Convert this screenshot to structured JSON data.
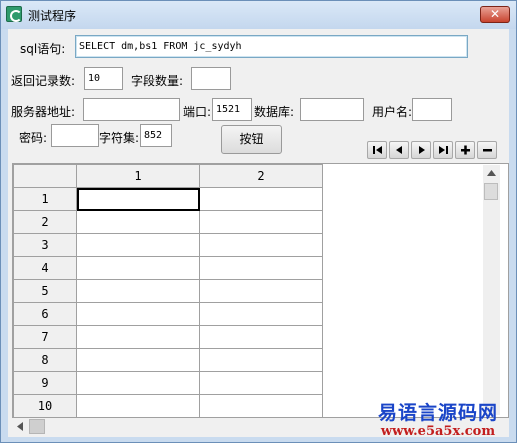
{
  "window": {
    "title": "测试程序",
    "close_glyph": "✕"
  },
  "form": {
    "sql_label": "sql语句:",
    "sql_value": "SELECT dm,bs1 FROM jc_sydyh",
    "record_count_label": "返回记录数:",
    "record_count_value": "10",
    "field_count_label": "字段数量:",
    "field_count_value": "",
    "server_label": "服务器地址:",
    "server_value": "",
    "port_label": "端口:",
    "port_value": "1521",
    "database_label": "数据库:",
    "database_value": "",
    "username_label": "用户名:",
    "username_value": "",
    "password_label": "密码:",
    "password_value": "",
    "charset_label": "字符集:",
    "charset_value": "852",
    "button_label": "按钮"
  },
  "navigator": {
    "buttons": [
      "first-record-icon",
      "prior-record-icon",
      "next-record-icon",
      "last-record-icon",
      "add-record-icon",
      "delete-record-icon"
    ]
  },
  "grid": {
    "columns": [
      "1",
      "2"
    ],
    "rows": [
      "1",
      "2",
      "3",
      "4",
      "5",
      "6",
      "7",
      "8",
      "9",
      "10"
    ],
    "active_cell": {
      "row": 1,
      "column": 1
    }
  },
  "watermark": {
    "line1": "易语言源码网",
    "line2": "www.e5a5x.com"
  },
  "colors": {
    "titlebar": "#c9dbef",
    "client": "#f0f0f0",
    "close": "#c8442f",
    "watermark_blue": "#1a45c8",
    "watermark_red": "#c21e1e"
  }
}
